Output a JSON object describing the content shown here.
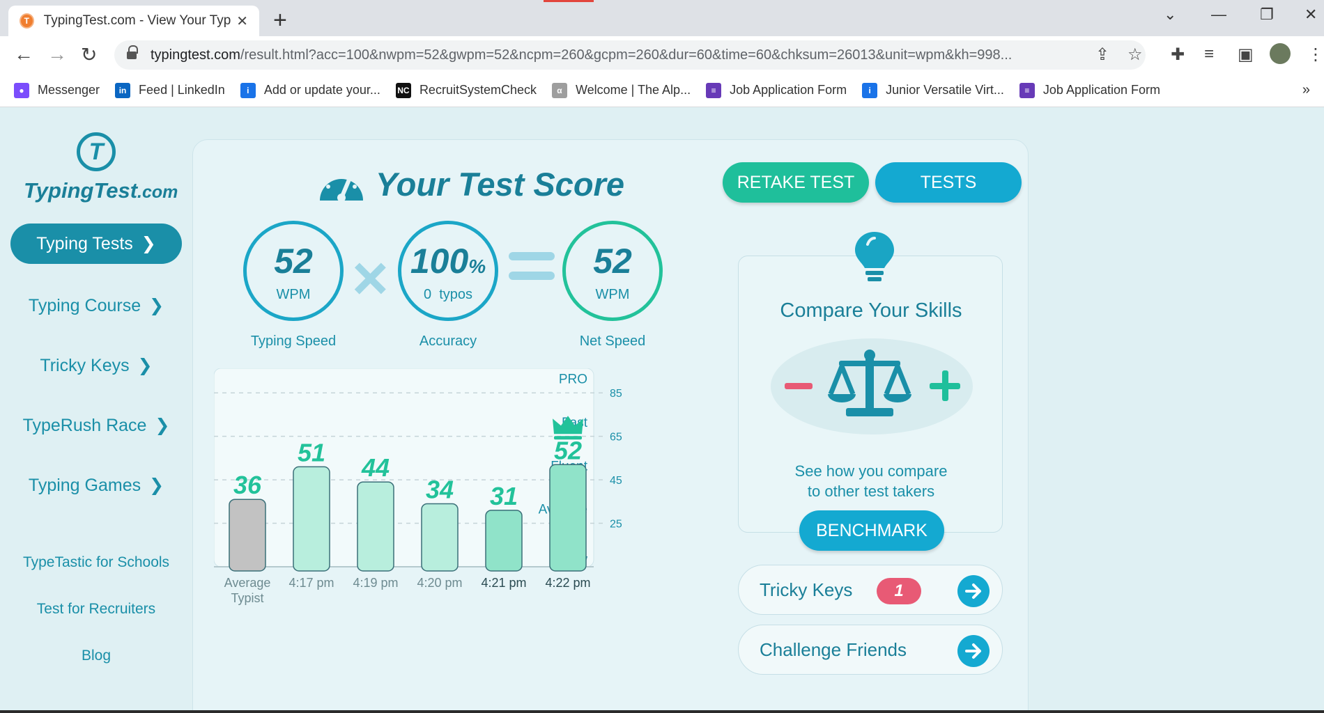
{
  "browser": {
    "tab_title": "TypingTest.com - View Your Typir",
    "tab_favicon_letter": "T",
    "url_domain": "typingtest.com",
    "url_path": "/result.html?acc=100&nwpm=52&gwpm=52&ncpm=260&gcpm=260&dur=60&time=60&chksum=26013&unit=wpm&kh=998...",
    "bookmarks": [
      {
        "label": "Messenger",
        "icon": "messenger-icon",
        "color": "#7b4dfc",
        "glyph": "●"
      },
      {
        "label": "Feed | LinkedIn",
        "icon": "linkedin-icon",
        "color": "#0a66c2",
        "glyph": "in"
      },
      {
        "label": "Add or update your...",
        "icon": "info-icon",
        "color": "#1a73e8",
        "glyph": "i"
      },
      {
        "label": "RecruitSystemCheck",
        "icon": "nc-icon",
        "color": "#111111",
        "glyph": "NC"
      },
      {
        "label": "Welcome | The Alp...",
        "icon": "alpha-icon",
        "color": "#9e9e9e",
        "glyph": "α"
      },
      {
        "label": "Job Application Form",
        "icon": "forms-icon",
        "color": "#673ab7",
        "glyph": "≡"
      },
      {
        "label": "Junior Versatile Virt...",
        "icon": "pin-icon",
        "color": "#1a73e8",
        "glyph": "i"
      },
      {
        "label": "Job Application Form",
        "icon": "forms-icon",
        "color": "#673ab7",
        "glyph": "≡"
      }
    ]
  },
  "sidebar": {
    "logo_mark": "T",
    "logo_name": "TypingTest",
    "logo_tld": ".com",
    "primary": "Typing Tests",
    "items": [
      "Typing Course",
      "Tricky Keys",
      "TypeRush Race",
      "Typing Games"
    ],
    "links": [
      "TypeTastic for Schools",
      "Test for Recruiters",
      "Blog"
    ]
  },
  "score": {
    "title": "Your Test Score",
    "speed_value": "52",
    "speed_unit": "WPM",
    "speed_label": "Typing Speed",
    "accuracy_value": "100",
    "accuracy_pct": "%",
    "accuracy_sub": "0  typos",
    "accuracy_label": "Accuracy",
    "net_value": "52",
    "net_unit": "WPM",
    "net_label": "Net Speed"
  },
  "chart_data": {
    "type": "bar",
    "categories": [
      "Average Typist",
      "4:17 pm",
      "4:19 pm",
      "4:20 pm",
      "4:21 pm",
      "4:22 pm"
    ],
    "values": [
      36,
      51,
      44,
      34,
      31,
      52
    ],
    "ylim": [
      5,
      95
    ],
    "gridlines": [
      85,
      65,
      45,
      25
    ],
    "levels": [
      {
        "label": "PRO",
        "value": 92
      },
      {
        "label": "Fast",
        "value": 72
      },
      {
        "label": "Fluent",
        "value": 52
      },
      {
        "label": "Average",
        "value": 32
      },
      {
        "label": "Slow",
        "value": 9
      }
    ],
    "best_index": 5,
    "colors": {
      "average": "#c2c2c2",
      "bar": "#b8eedd",
      "bar_highlight": "#90e3c9",
      "value_text": "#22c29a",
      "grid": "#c5d4d8",
      "axis_text": "#1a8fa8"
    }
  },
  "actions": {
    "retake": "RETAKE TEST",
    "tests": "TESTS",
    "compare_title": "Compare Your Skills",
    "compare_line1": "See how you compare",
    "compare_line2": "to other test takers",
    "benchmark": "BENCHMARK",
    "tricky_keys": "Tricky Keys",
    "tricky_count": "1",
    "challenge": "Challenge Friends"
  },
  "colors": {
    "brand": "#1a8fa8",
    "green": "#1fbf9b",
    "blue": "#14a9d1",
    "badge": "#e85a75"
  }
}
